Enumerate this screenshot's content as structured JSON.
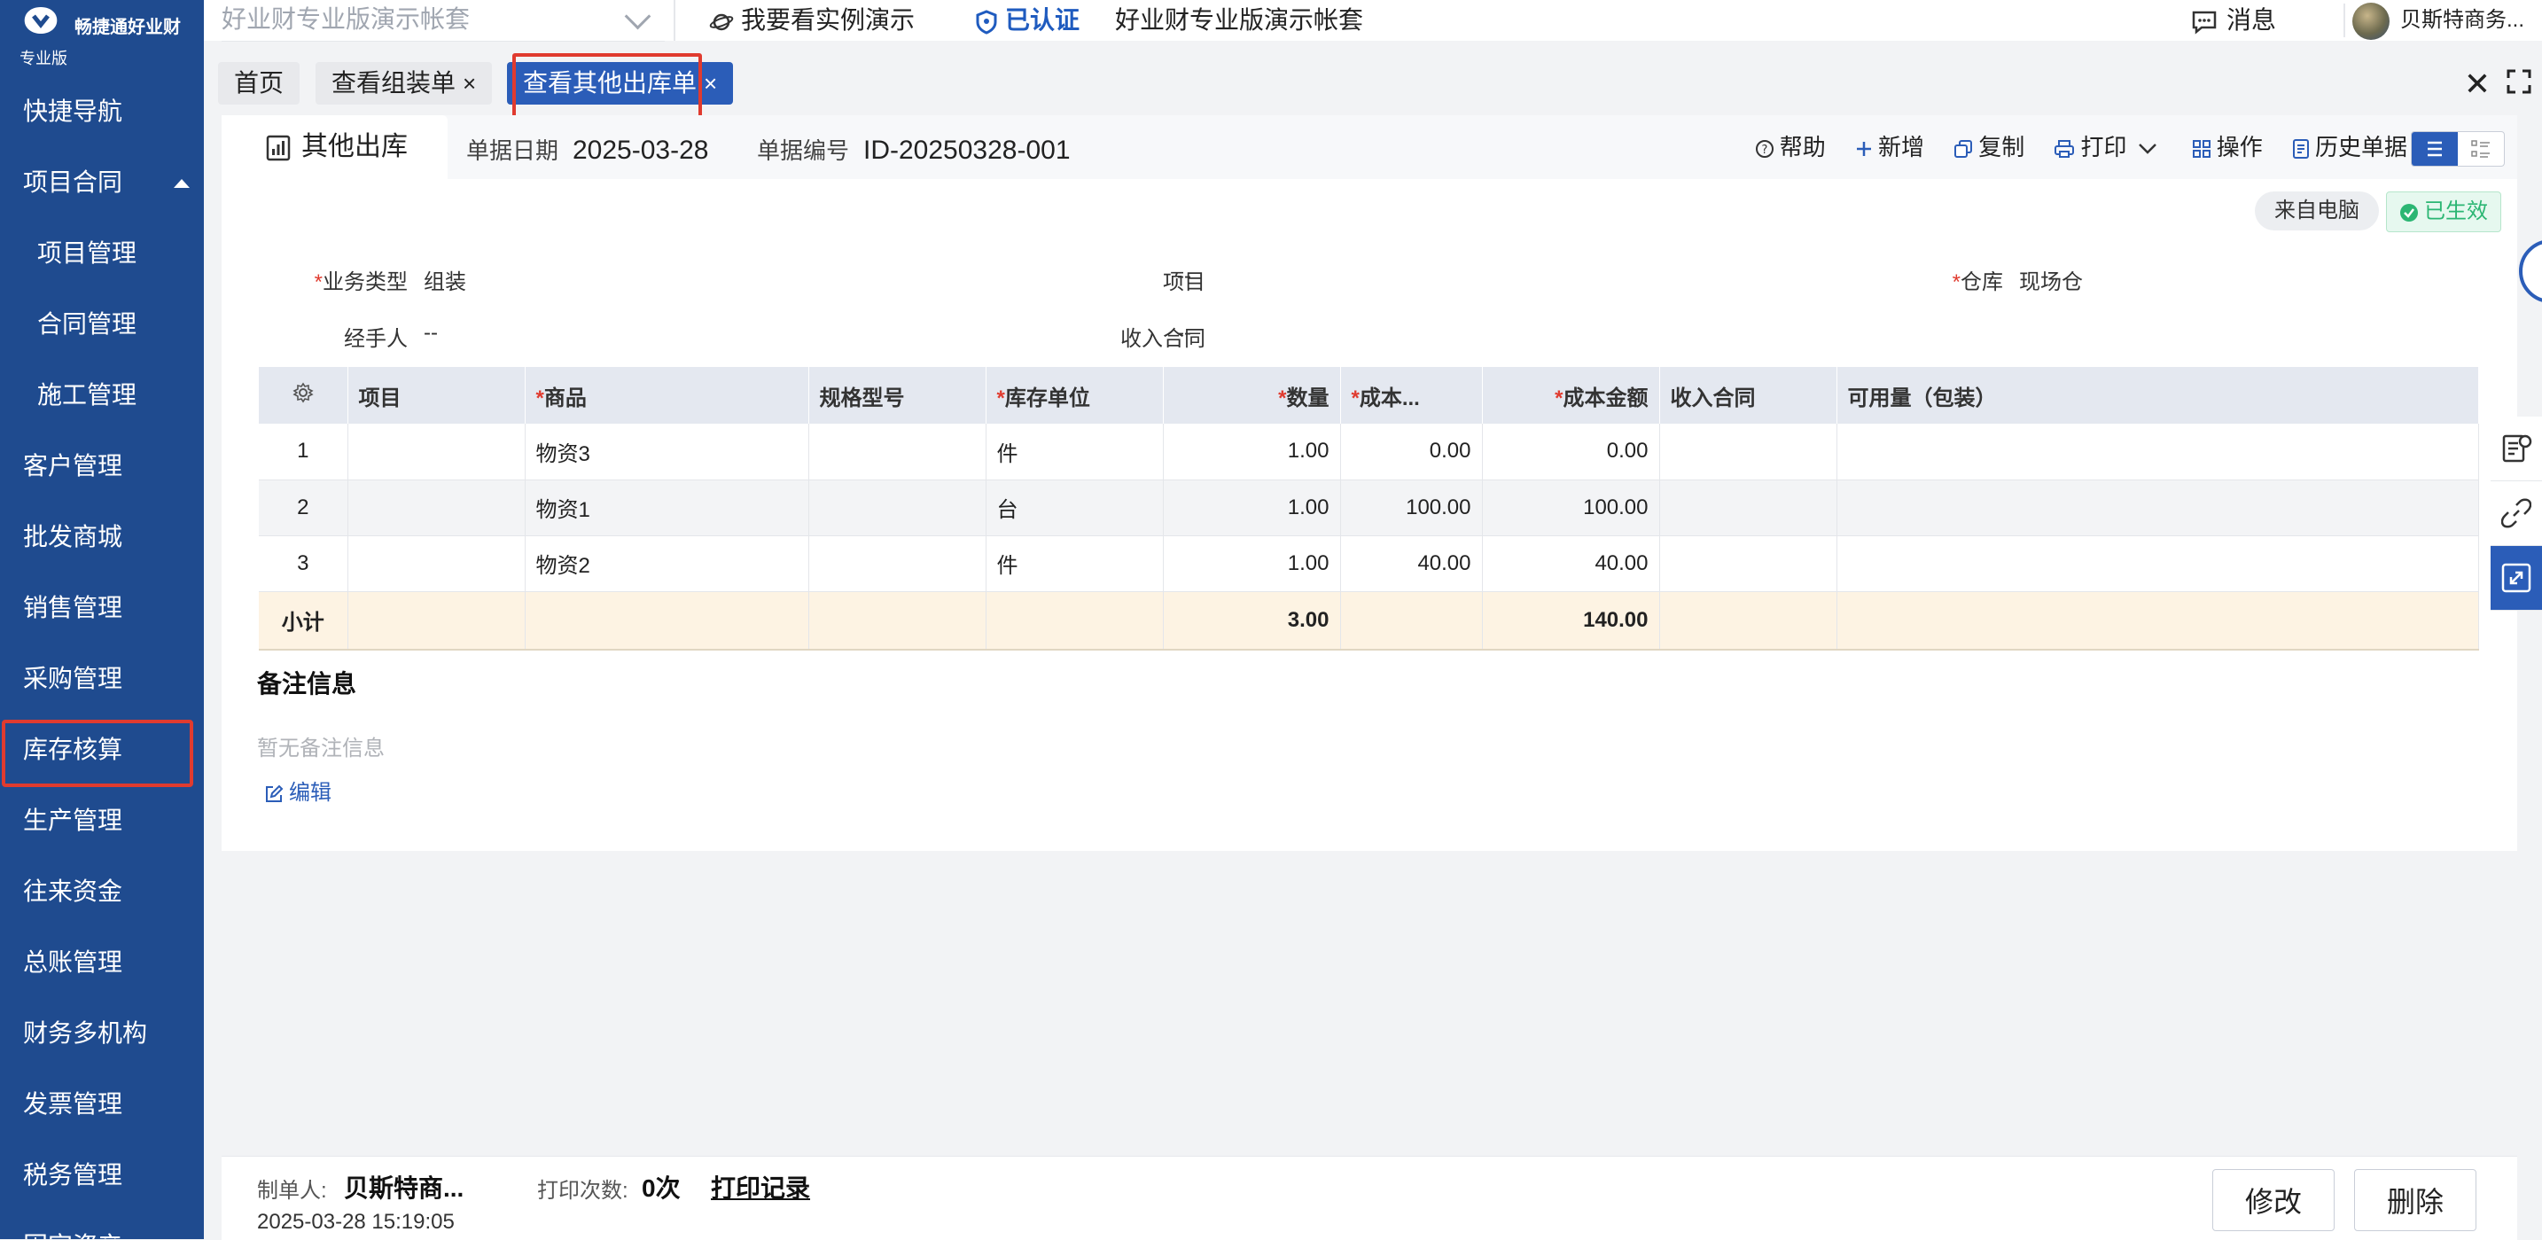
{
  "brand": {
    "name": "畅捷通好业财",
    "edition": "专业版"
  },
  "sidebar": {
    "items": [
      {
        "label": "快捷导航"
      },
      {
        "label": "项目合同"
      },
      {
        "label": "项目管理"
      },
      {
        "label": "合同管理"
      },
      {
        "label": "施工管理"
      },
      {
        "label": "客户管理"
      },
      {
        "label": "批发商城"
      },
      {
        "label": "销售管理"
      },
      {
        "label": "采购管理"
      },
      {
        "label": "库存核算"
      },
      {
        "label": "生产管理"
      },
      {
        "label": "往来资金"
      },
      {
        "label": "总账管理"
      },
      {
        "label": "财务多机构"
      },
      {
        "label": "发票管理"
      },
      {
        "label": "税务管理"
      },
      {
        "label": "固定资产"
      }
    ]
  },
  "header": {
    "account_select": "好业财专业版演示帐套",
    "demo_link": "我要看实例演示",
    "certified": "已认证",
    "account_name": "好业财专业版演示帐套",
    "messages": "消息",
    "user": "贝斯特商务..."
  },
  "tabs": [
    {
      "label": "首页"
    },
    {
      "label": "查看组装单"
    },
    {
      "label": "查看其他出库单"
    }
  ],
  "document": {
    "tab_label": "其他出库",
    "date_label": "单据日期",
    "date": "2025-03-28",
    "number_label": "单据编号",
    "number": "ID-20250328-001",
    "toolbar": {
      "help": "帮助",
      "add": "新增",
      "copy": "复制",
      "print": "打印",
      "ops": "操作",
      "history": "历史单据"
    },
    "source_badge": "来自电脑",
    "status_badge": "已生效",
    "fields": {
      "biz_type_label": "业务类型",
      "biz_type": "组装",
      "project_label": "项目",
      "project": "--",
      "warehouse_label": "仓库",
      "warehouse": "现场仓",
      "handler_label": "经手人",
      "handler": "--",
      "income_contract_label": "收入合同",
      "income_contract": "--"
    }
  },
  "table": {
    "columns": [
      "项目",
      "商品",
      "规格型号",
      "库存单位",
      "数量",
      "成本...",
      "成本金额",
      "收入合同",
      "可用量（包装）"
    ],
    "rows": [
      {
        "idx": "1",
        "project": "",
        "product": "物资3",
        "spec": "",
        "unit": "件",
        "qty": "1.00",
        "cost": "0.00",
        "amount": "0.00",
        "contract": "",
        "avail": ""
      },
      {
        "idx": "2",
        "project": "",
        "product": "物资1",
        "spec": "",
        "unit": "台",
        "qty": "1.00",
        "cost": "100.00",
        "amount": "100.00",
        "contract": "",
        "avail": ""
      },
      {
        "idx": "3",
        "project": "",
        "product": "物资2",
        "spec": "",
        "unit": "件",
        "qty": "1.00",
        "cost": "40.00",
        "amount": "40.00",
        "contract": "",
        "avail": ""
      }
    ],
    "total": {
      "label": "小计",
      "qty": "3.00",
      "amount": "140.00"
    }
  },
  "notes": {
    "title": "备注信息",
    "empty": "暂无备注信息",
    "edit": "编辑"
  },
  "footer": {
    "creator_label": "制单人:",
    "creator": "贝斯特商...",
    "print_count_label": "打印次数:",
    "print_count": "0次",
    "print_record": "打印记录",
    "created_at": "2025-03-28 15:19:05",
    "modify": "修改",
    "delete": "删除"
  }
}
